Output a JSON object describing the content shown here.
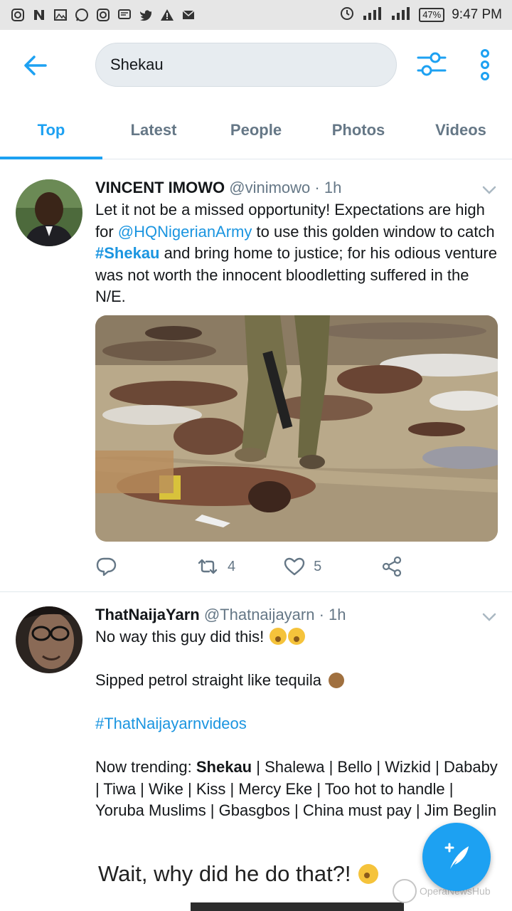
{
  "status_bar": {
    "left_icons": [
      "instagram-icon",
      "n-app-icon",
      "gallery-icon",
      "whatsapp-icon",
      "instagram-icon",
      "message-icon",
      "twitter-icon",
      "warning-icon",
      "mail-icon"
    ],
    "battery": "47%",
    "time": "9:47 PM"
  },
  "search": {
    "query": "Shekau"
  },
  "tabs": [
    {
      "label": "Top",
      "active": true
    },
    {
      "label": "Latest",
      "active": false
    },
    {
      "label": "People",
      "active": false
    },
    {
      "label": "Photos",
      "active": false
    },
    {
      "label": "Videos",
      "active": false
    }
  ],
  "tweets": [
    {
      "name": "VINCENT IMOWO",
      "handle": "@vinimowo",
      "time": "· 1h",
      "text": {
        "p1": "Let it not be a missed opportunity! Expectations are high for ",
        "mention": "@HQNigerianArmy",
        "p2": " to use this golden window to catch ",
        "hashtag": "#Shekau",
        "p3": " and bring home to justice; for his odious venture was not worth the innocent bloodletting suffered in the N/E."
      },
      "retweets": "4",
      "likes": "5"
    },
    {
      "name": "ThatNaijaYarn",
      "handle": "@Thatnaijayarn",
      "time": "· 1h",
      "line1": "No way this guy did this!",
      "line2": "Sipped petrol straight like tequila",
      "hashtag": "#ThatNaijayarnvideos",
      "trending_prefix": "Now trending: ",
      "trending_bold": "Shekau",
      "trending_rest": " | Shalewa | Bello | Wizkid | Dababy | Tiwa | Wike | Kiss | Mercy Eke | Too hot to handle | Yoruba Muslims | Gbasgbos | China must pay | Jim Beglin",
      "preview_caption": "Wait, why did he do that?!"
    }
  ],
  "watermark": "OperaNewsHub",
  "colors": {
    "accent": "#1da1f2",
    "link": "#1b95e0",
    "secondary_text": "#657786"
  }
}
